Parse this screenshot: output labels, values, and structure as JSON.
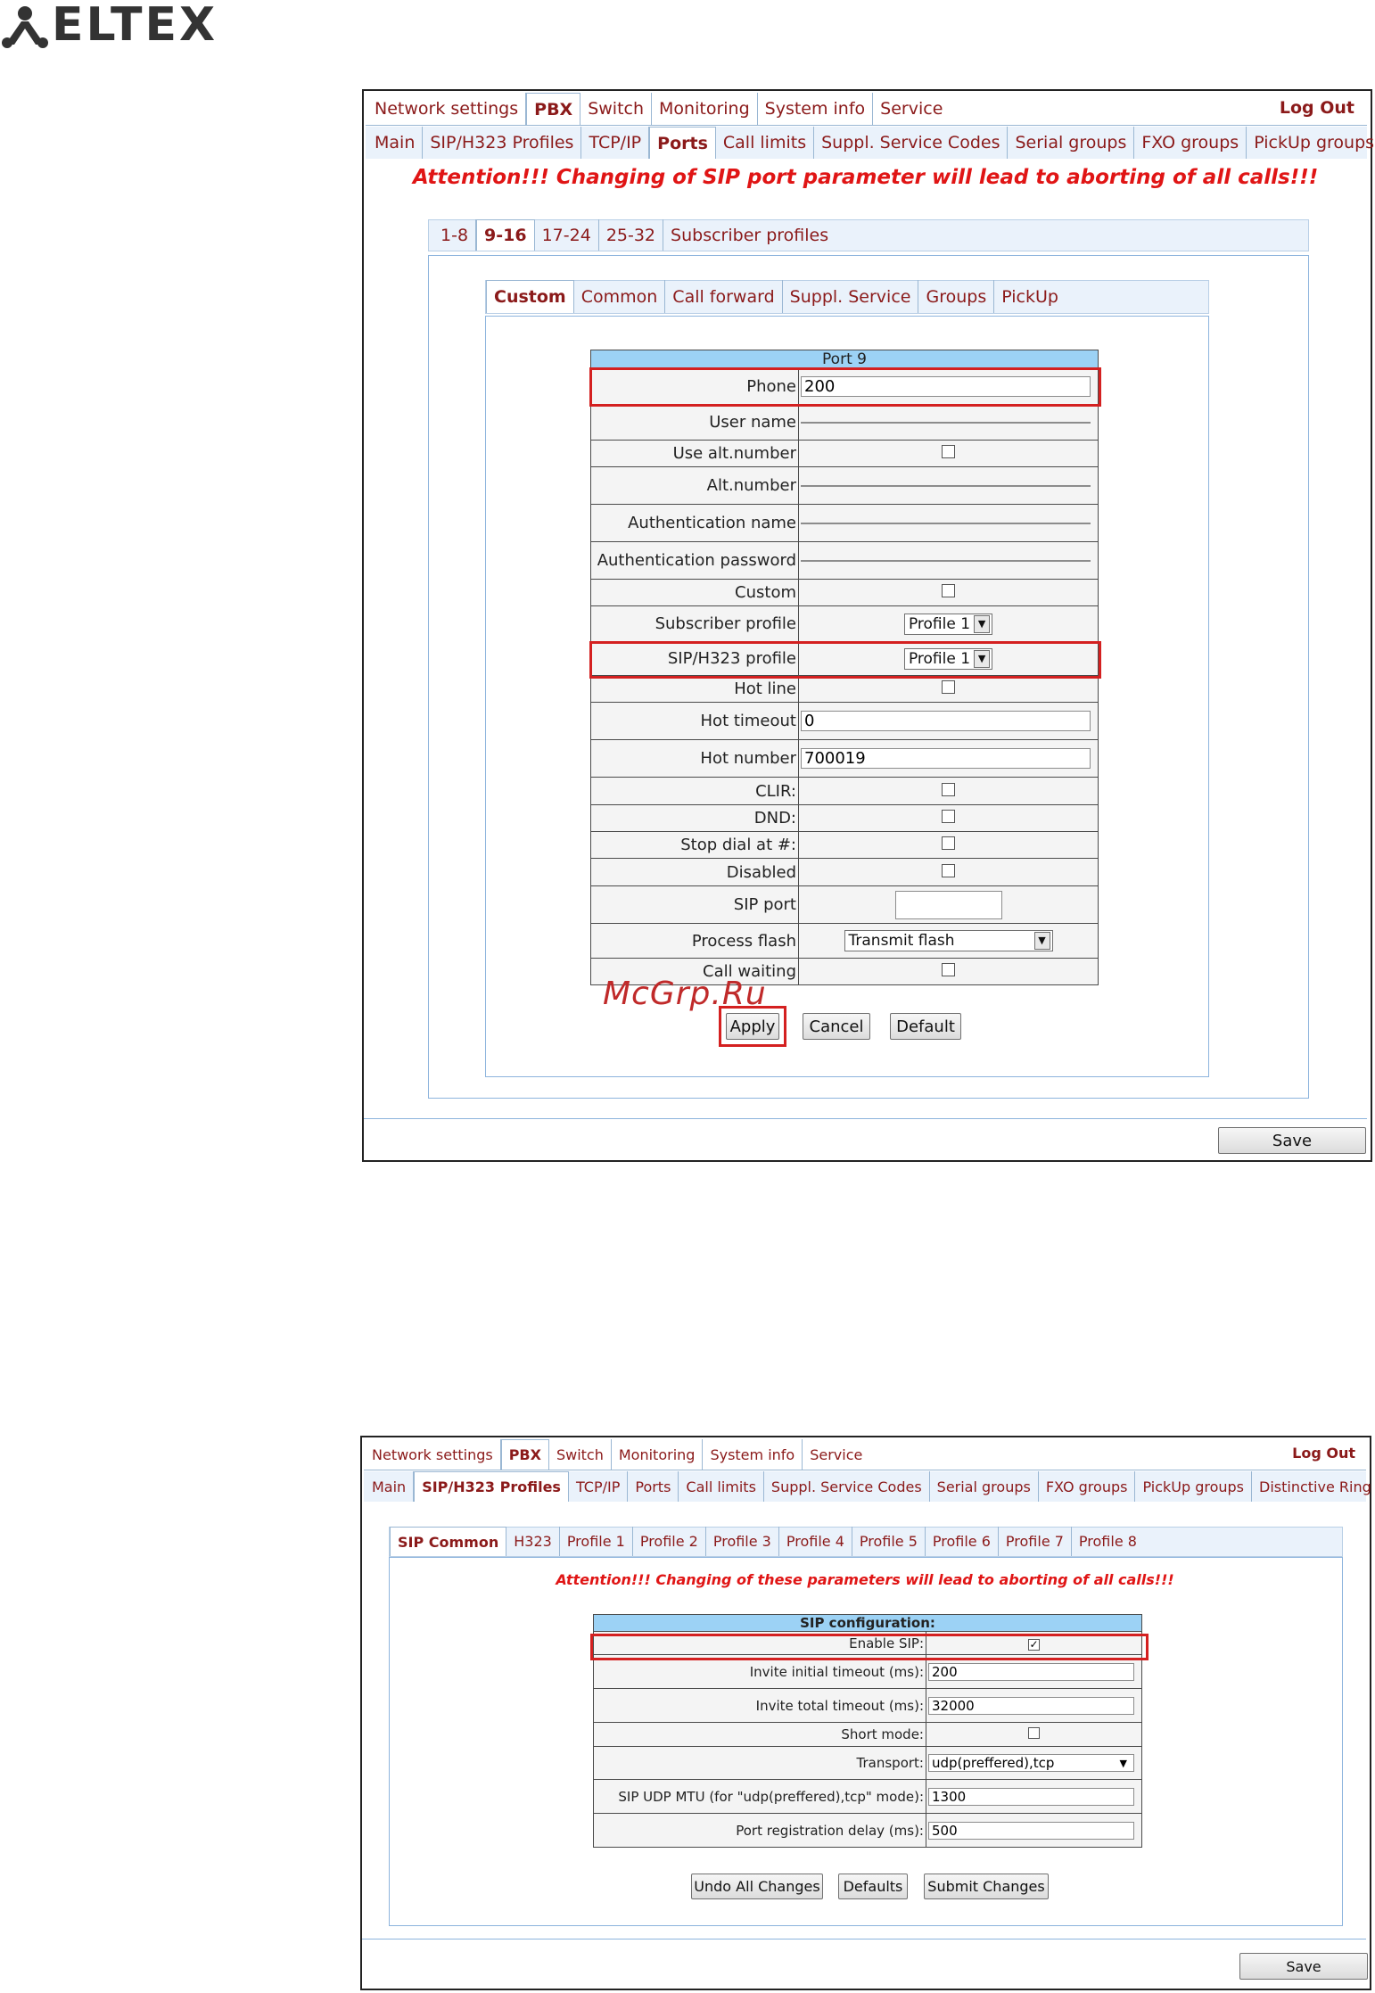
{
  "logo": {
    "text": "ELTEX"
  },
  "watermark": "McGrp.Ru",
  "screen1": {
    "top_tabs": [
      "Network settings",
      "PBX",
      "Switch",
      "Monitoring",
      "System info",
      "Service"
    ],
    "top_active": "PBX",
    "logout": "Log Out",
    "sub_tabs": [
      "Main",
      "SIP/H323 Profiles",
      "TCP/IP",
      "Ports",
      "Call limits",
      "Suppl. Service Codes",
      "Serial groups",
      "FXO groups",
      "PickUp groups"
    ],
    "sub_active": "Ports",
    "attention": "Attention!!! Changing of SIP port parameter will lead to aborting of all calls!!!",
    "port_tabs": [
      "1-8",
      "9-16",
      "17-24",
      "25-32",
      "Subscriber profiles"
    ],
    "port_active": "9-16",
    "inner_tabs": [
      "Custom",
      "Common",
      "Call forward",
      "Suppl. Service",
      "Groups",
      "PickUp"
    ],
    "inner_active": "Custom",
    "table_title": "Port 9",
    "rows": {
      "phone": {
        "label": "Phone",
        "value": "200"
      },
      "user_name": {
        "label": "User name",
        "value": ""
      },
      "use_alt": {
        "label": "Use alt.number",
        "checked": false
      },
      "alt_number": {
        "label": "Alt.number",
        "value": ""
      },
      "auth_name": {
        "label": "Authentication name",
        "value": ""
      },
      "auth_password": {
        "label": "Authentication password",
        "value": ""
      },
      "custom": {
        "label": "Custom",
        "checked": false
      },
      "subscriber_profile": {
        "label": "Subscriber profile",
        "value": "Profile 1"
      },
      "sip_profile": {
        "label": "SIP/H323 profile",
        "value": "Profile 1"
      },
      "hot_line": {
        "label": "Hot line",
        "checked": false
      },
      "hot_timeout": {
        "label": "Hot timeout",
        "value": "0"
      },
      "hot_number": {
        "label": "Hot number",
        "value": "700019"
      },
      "clir": {
        "label": "CLIR:",
        "checked": false
      },
      "dnd": {
        "label": "DND:",
        "checked": false
      },
      "stop_dial": {
        "label": "Stop dial at #:",
        "checked": false
      },
      "disabled": {
        "label": "Disabled",
        "checked": false
      },
      "sip_port": {
        "label": "SIP port",
        "value": ""
      },
      "process_flash": {
        "label": "Process flash",
        "value": "Transmit flash"
      },
      "call_waiting": {
        "label": "Call waiting",
        "checked": false
      }
    },
    "buttons": {
      "apply": "Apply",
      "cancel": "Cancel",
      "default": "Default"
    },
    "save": "Save"
  },
  "screen2": {
    "top_tabs": [
      "Network settings",
      "PBX",
      "Switch",
      "Monitoring",
      "System info",
      "Service"
    ],
    "top_active": "PBX",
    "logout": "Log Out",
    "sub_tabs": [
      "Main",
      "SIP/H323 Profiles",
      "TCP/IP",
      "Ports",
      "Call limits",
      "Suppl. Service Codes",
      "Serial groups",
      "FXO groups",
      "PickUp groups",
      "Distinctive Ring"
    ],
    "sub_active": "SIP/H323 Profiles",
    "profile_tabs": [
      "SIP Common",
      "H323",
      "Profile 1",
      "Profile 2",
      "Profile 3",
      "Profile 4",
      "Profile 5",
      "Profile 6",
      "Profile 7",
      "Profile 8"
    ],
    "profile_active": "SIP Common",
    "attention": "Attention!!! Changing of these parameters will lead to aborting of all calls!!!",
    "table_title": "SIP configuration:",
    "rows": {
      "enable_sip": {
        "label": "Enable SIP:",
        "checked": true
      },
      "invite_initial": {
        "label": "Invite initial timeout (ms):",
        "value": "200"
      },
      "invite_total": {
        "label": "Invite total timeout (ms):",
        "value": "32000"
      },
      "short_mode": {
        "label": "Short mode:",
        "checked": false
      },
      "transport": {
        "label": "Transport:",
        "value": "udp(preffered),tcp"
      },
      "udp_mtu": {
        "label": "SIP UDP MTU (for \"udp(preffered),tcp\" mode):",
        "value": "1300"
      },
      "reg_delay": {
        "label": "Port registration delay (ms):",
        "value": "500"
      }
    },
    "buttons": {
      "undo": "Undo All Changes",
      "defaults": "Defaults",
      "submit": "Submit Changes"
    },
    "save": "Save"
  }
}
